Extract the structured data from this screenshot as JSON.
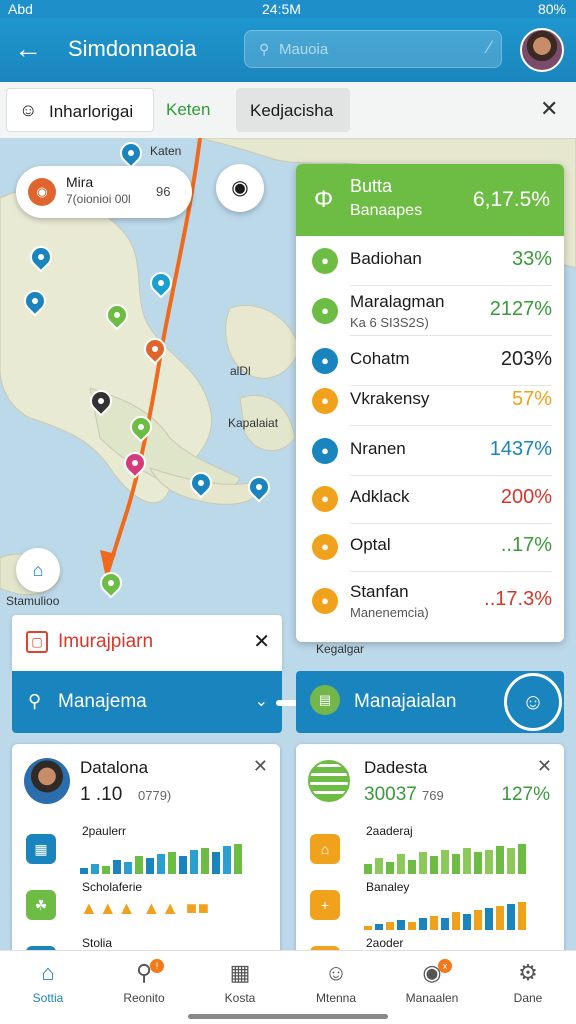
{
  "status": {
    "carrier": "Abd",
    "time": "24:5M",
    "battery": "80%"
  },
  "header": {
    "title": "Simdonnaoia",
    "search_placeholder": "Mauoia"
  },
  "filters": {
    "user_chip": "Inharlorigai",
    "chip_green": "Keten",
    "chip_selected": "Kedjacisha"
  },
  "map": {
    "popup": {
      "title": "Mira",
      "subtitle": "7(oionioi 00l",
      "value": "96"
    },
    "labels": {
      "top": "Katen",
      "a1": "alDl",
      "a2": "Kapalaiat",
      "a3": "Kegalgar",
      "loc_label": "Stamulioo"
    }
  },
  "stats": {
    "header": {
      "title": "Butta",
      "subtitle": "Banaapes",
      "value": "6,17.5%"
    },
    "rows": [
      {
        "name": "Badiohan",
        "sub": "",
        "value": "33%",
        "color": "#3b9b3a",
        "icon_color": "#6dbd44"
      },
      {
        "name": "Maralagman",
        "sub": "Ka 6 SI3S2S)",
        "value": "2127%",
        "color": "#3b9b3a",
        "icon_color": "#6dbd44"
      },
      {
        "name": "Cohatm",
        "sub": "",
        "value": "203%",
        "color": "#222222",
        "icon_color": "#1a84bf"
      },
      {
        "name": "Vkrakensy",
        "sub": "",
        "value": "57%",
        "color": "#f1a21c",
        "icon_color": "#f1a21c"
      },
      {
        "name": "Nranen",
        "sub": "",
        "value": "1437%",
        "color": "#1a84bf",
        "icon_color": "#1a84bf"
      },
      {
        "name": "Adklack",
        "sub": "",
        "value": "200%",
        "color": "#d9362b",
        "icon_color": "#f1a21c"
      },
      {
        "name": "Optal",
        "sub": "",
        "value": "..17%",
        "color": "#3b9b3a",
        "icon_color": "#f1a21c"
      },
      {
        "name": "Stanfan",
        "sub": "Manenemcia)",
        "value": "..17.3%",
        "color": "#d9362b",
        "icon_color": "#f1a21c"
      }
    ]
  },
  "alert": {
    "label": "Imurajpiarn"
  },
  "management": {
    "left_label": "Manajema",
    "right_label": "Manajaialan"
  },
  "card_left": {
    "title": "Datalona",
    "value": "1 .10",
    "value_sub": "0779)",
    "metrics": [
      {
        "name": "2paulerr"
      },
      {
        "name": "Scholaferie"
      },
      {
        "name": "Stolia"
      }
    ]
  },
  "card_right": {
    "title": "Dadesta",
    "value": "30037",
    "value_sub": "769",
    "pct": "127%",
    "metrics": [
      {
        "name": "2aaderaj"
      },
      {
        "name": "Banaley"
      },
      {
        "name": "2aoder"
      }
    ]
  },
  "nav": [
    {
      "label": "Sottia",
      "icon": "home-icon"
    },
    {
      "label": "Reonito",
      "icon": "search-icon"
    },
    {
      "label": "Kosta",
      "icon": "grid-icon"
    },
    {
      "label": "Mtenna",
      "icon": "user-icon"
    },
    {
      "label": "Manaalen",
      "icon": "pin-icon"
    },
    {
      "label": "Dane",
      "icon": "settings-icon"
    }
  ]
}
